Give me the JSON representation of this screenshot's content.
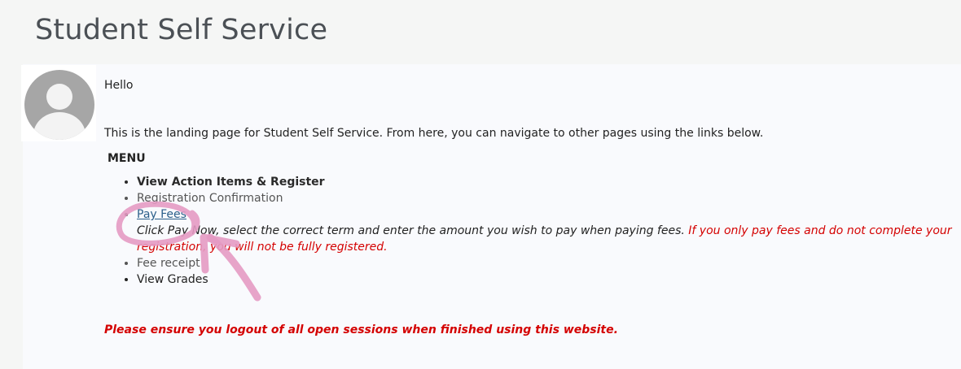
{
  "page": {
    "title": "Student Self Service"
  },
  "welcome": {
    "greeting": "Hello",
    "intro": "This is the landing page for Student Self Service. From here, you can navigate to other pages using the links below."
  },
  "menu": {
    "heading": "MENU",
    "items": [
      {
        "label": "View Action Items & Register"
      },
      {
        "label": "Registration Confirmation"
      },
      {
        "label": "Pay Fees",
        "hint": "Click Pay Now, select the correct term and enter the amount you wish to pay when paying fees.",
        "warning": "If you only pay fees and do not complete your registration, you will not be fully registered."
      },
      {
        "label": "Fee receipt"
      },
      {
        "label": "View Grades"
      }
    ]
  },
  "footer": {
    "notice": "Please ensure you logout of all open sessions when finished using this website."
  },
  "colors": {
    "warning": "#d40000",
    "link": "#2b5f8a",
    "annotation": "#e49ac3"
  },
  "icons": {
    "avatar": "user-avatar-icon"
  }
}
